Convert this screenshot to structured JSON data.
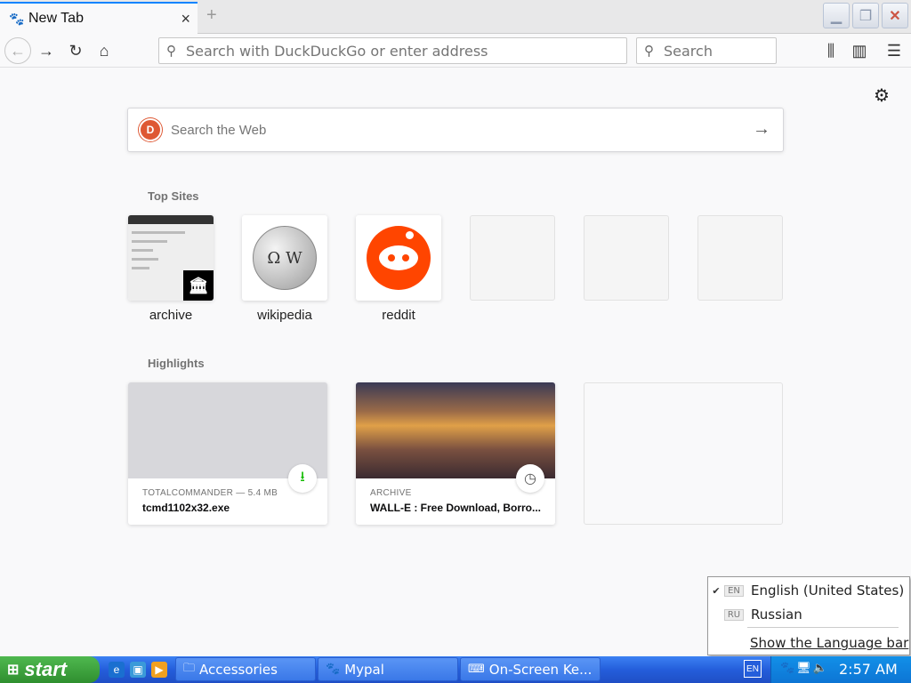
{
  "browser": {
    "tab_title": "New Tab",
    "tab_close": "×",
    "new_tab": "+",
    "url_placeholder": "Search with DuckDuckGo or enter address",
    "search_placeholder": "Search"
  },
  "content": {
    "web_search_placeholder": "Search the Web",
    "top_sites_title": "Top Sites",
    "highlights_title": "Highlights",
    "top_sites": [
      {
        "label": "archive"
      },
      {
        "label": "wikipedia"
      },
      {
        "label": "reddit"
      }
    ],
    "highlights": [
      {
        "meta": "TOTALCOMMANDER — 5.4 MB",
        "title": "tcmd1102x32.exe",
        "badge_icon": "download-icon"
      },
      {
        "meta": "ARCHIVE",
        "title": "WALL-E : Free Download, Borro...",
        "badge_icon": "clock-icon"
      }
    ]
  },
  "language_menu": {
    "items": [
      {
        "code": "EN",
        "name": "English (United States)",
        "checked": true
      },
      {
        "code": "RU",
        "name": "Russian",
        "checked": false
      }
    ],
    "show_bar": "Show the Language bar"
  },
  "taskbar": {
    "start_label": "start",
    "buttons": [
      {
        "label": "Accessories"
      },
      {
        "label": "Mypal"
      },
      {
        "label": "On-Screen Ke..."
      }
    ],
    "lang_indicator": "EN",
    "clock": "2:57 AM"
  },
  "colors": {
    "accent": "#0a84ff",
    "reddit": "#ff4500",
    "duckduckgo": "#de5833",
    "download_green": "#12bc00"
  }
}
